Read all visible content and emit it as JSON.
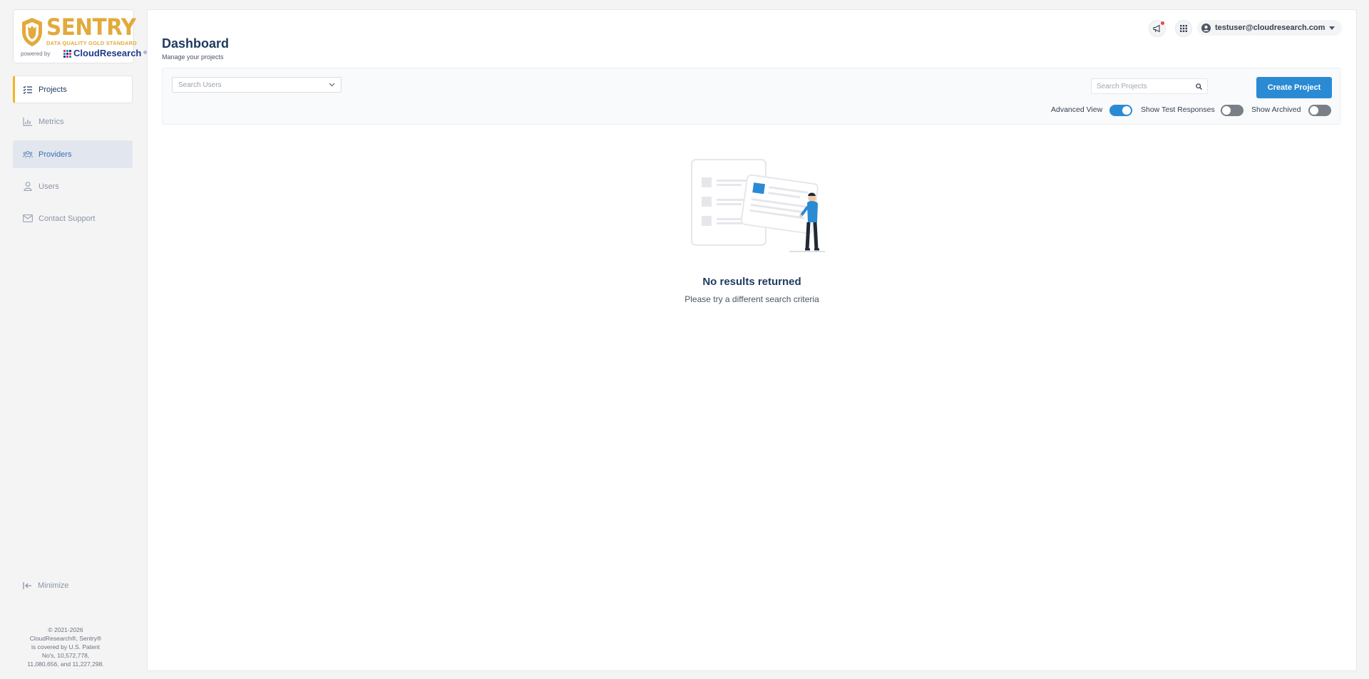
{
  "brand": {
    "logo_word": "SENTRY",
    "logo_tagline": "DATA QUALITY GOLD STANDARD",
    "powered_by": "powered by",
    "company": "CloudResearch",
    "company_mark": "®"
  },
  "sidebar": {
    "items": [
      {
        "label": "Projects",
        "icon": "list-check-icon",
        "state": "active"
      },
      {
        "label": "Metrics",
        "icon": "bar-chart-icon",
        "state": "normal"
      },
      {
        "label": "Providers",
        "icon": "people-group-icon",
        "state": "hover"
      },
      {
        "label": "Users",
        "icon": "user-icon",
        "state": "normal"
      },
      {
        "label": "Contact Support",
        "icon": "envelope-icon",
        "state": "normal"
      }
    ],
    "minimize_label": "Minimize",
    "copyright_lines": [
      "© 2021-2026",
      "CloudResearch®, Sentry®",
      "is covered by U.S. Patent",
      "No's, 10,572,778,",
      "11,080,656, and 11,227,298."
    ]
  },
  "topbar": {
    "user_email": "testuser@cloudresearch.com",
    "icons": [
      "megaphone-icon",
      "apps-grid-icon",
      "user-circle-icon",
      "caret-down-icon"
    ]
  },
  "page": {
    "title": "Dashboard",
    "subtitle": "Manage your projects"
  },
  "filters": {
    "users_placeholder": "Search Users",
    "projects_placeholder": "Search Projects",
    "create_label": "Create Project",
    "toggles": [
      {
        "label": "Advanced View",
        "on": true
      },
      {
        "label": "Show Test Responses",
        "on": false
      },
      {
        "label": "Show Archived",
        "on": false
      }
    ]
  },
  "empty_state": {
    "title": "No results returned",
    "message": "Please try a different search criteria"
  },
  "colors": {
    "accent": "#2b8ad4",
    "brand_gold": "#e3a93b",
    "title_navy": "#1e3a5f",
    "active_indicator": "#f0b429"
  }
}
